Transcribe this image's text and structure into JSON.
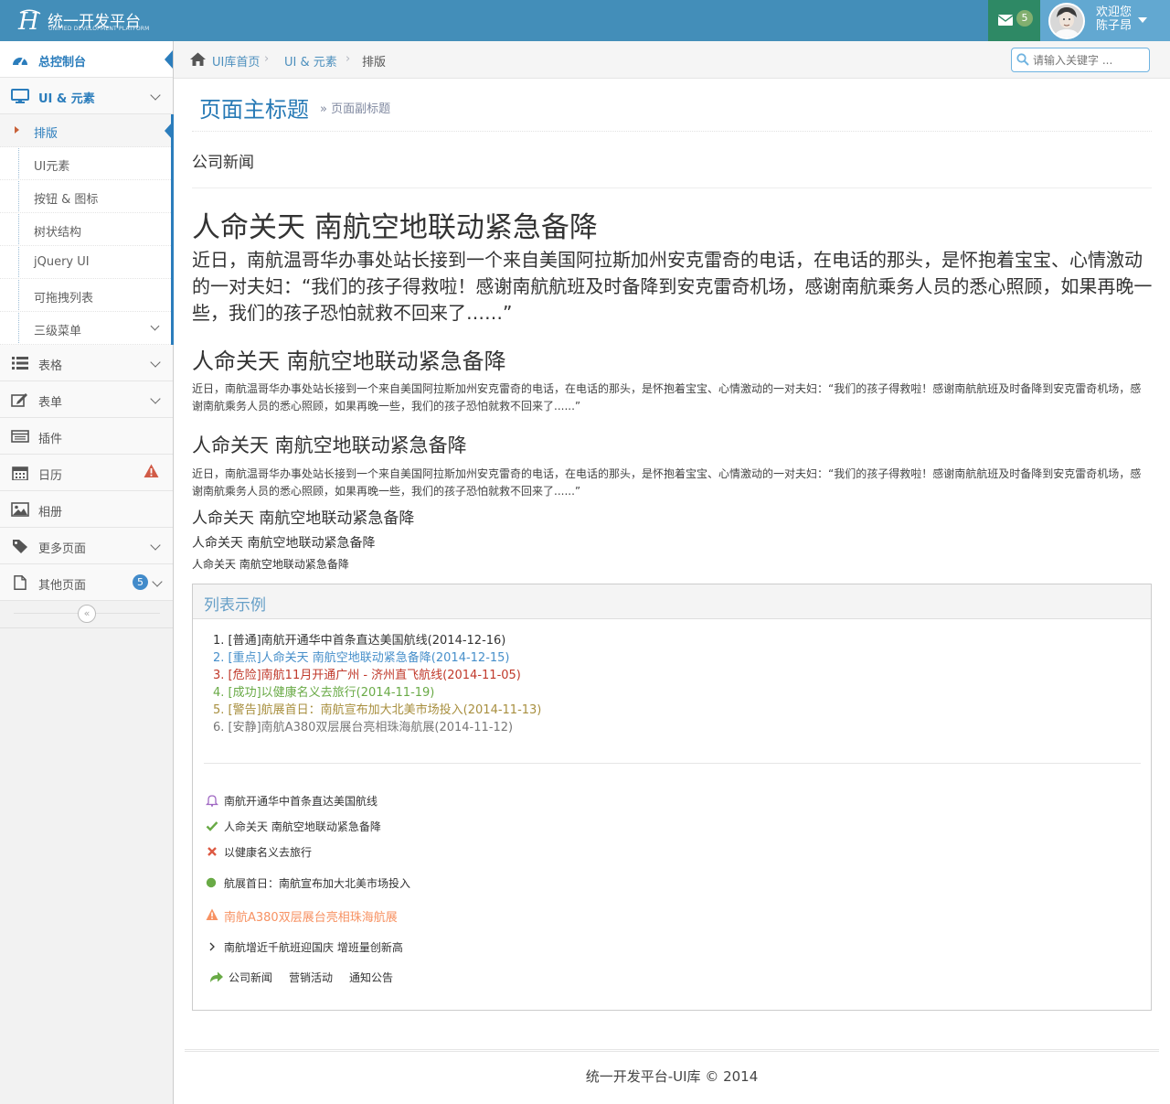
{
  "navbar": {
    "brand_title": "统一开发平台",
    "brand_subtitle": "UNIFIED DEVELOPMENT PLATFORM",
    "mail_count": "5",
    "welcome": "欢迎您",
    "username": "陈子昂",
    "colors": {
      "bar": "#438eb9",
      "mail_bg": "#2e8965",
      "user_bg": "#62a8d1"
    }
  },
  "sidebar": {
    "items": [
      {
        "label": "总控制台",
        "icon": "dashboard-icon"
      },
      {
        "label": "UI & 元素",
        "icon": "desktop-icon"
      },
      {
        "label": "表格",
        "icon": "list-icon"
      },
      {
        "label": "表单",
        "icon": "edit-icon"
      },
      {
        "label": "插件",
        "icon": "plugin-icon"
      },
      {
        "label": "日历",
        "icon": "calendar-icon"
      },
      {
        "label": "相册",
        "icon": "picture-icon"
      },
      {
        "label": "更多页面",
        "icon": "tag-icon"
      },
      {
        "label": "其他页面",
        "icon": "file-icon",
        "badge": "5"
      }
    ],
    "submenu": [
      "排版",
      "UI元素",
      "按钮 & 图标",
      "树状结构",
      "jQuery UI",
      "可拖拽列表",
      "三级菜单"
    ]
  },
  "breadcrumb": {
    "home": "UI库首页",
    "section": "UI & 元素",
    "current": "排版"
  },
  "search": {
    "placeholder": "请输入关键字 ..."
  },
  "page": {
    "title": "页面主标题",
    "subtitle": "» 页面副标题",
    "section_label": "公司新闻"
  },
  "article": {
    "heading": "人命关天 南航空地联动紧急备降",
    "body": "近日，南航温哥华办事处站长接到一个来自美国阿拉斯加州安克雷奇的电话，在电话的那头，是怀抱着宝宝、心情激动的一对夫妇：“我们的孩子得救啦！感谢南航航班及时备降到安克雷奇机场，感谢南航乘务人员的悉心照顾，如果再晚一些，我们的孩子恐怕就救不回来了……”",
    "body_small": "近日，南航温哥华办事处站长接到一个来自美国阿拉斯加州安克雷奇的电话，在电话的那头，是怀抱着宝宝、心情激动的一对夫妇：“我们的孩子得救啦！感谢南航航班及时备降到安克雷奇机场，感谢南航乘务人员的悉心照顾，如果再晚一些，我们的孩子恐怕就救不回来了......”"
  },
  "widget": {
    "title": "列表示例",
    "ordered": [
      {
        "text": "1. [普通]南航开通华中首条直达美国航线(2014-12-16)",
        "color": "#333333"
      },
      {
        "text": "2. [重点]人命关天 南航空地联动紧急备降(2014-12-15)",
        "color": "#478fca"
      },
      {
        "text": "3. [危险]南航11月开通广州 - 济州直飞航线(2014-11-05)",
        "color": "#c0392b"
      },
      {
        "text": "4. [成功]以健康名义去旅行(2014-11-19)",
        "color": "#69aa46"
      },
      {
        "text": "5. [警告]航展首日：南航宣布加大北美市场投入(2014-11-13)",
        "color": "#a88f3f"
      },
      {
        "text": "6. [安静]南航A380双层展台亮相珠海航展(2014-11-12)",
        "color": "#777777"
      }
    ],
    "icon_list": [
      {
        "text": "南航开通华中首条直达美国航线",
        "icon": "bell-icon",
        "color": "#a069c3"
      },
      {
        "text": "人命关天 南航空地联动紧急备降",
        "icon": "check-icon",
        "color": "#69aa46"
      },
      {
        "text": "以健康名义去旅行",
        "icon": "times-icon",
        "color": "#dd5a43"
      },
      {
        "text": "航展首日：南航宣布加大北美市场投入",
        "icon": "circle-icon",
        "color": "#69aa46"
      },
      {
        "text": "南航A380双层展台亮相珠海航展",
        "icon": "warning-icon",
        "color": "#f79263"
      },
      {
        "text": "南航增近千航班迎国庆 增班量创新高",
        "icon": "angle-right-icon",
        "color": "#333333"
      }
    ],
    "links": [
      "公司新闻",
      "营销活动",
      "通知公告"
    ]
  },
  "footer": {
    "text": "统一开发平台-UI库 © 2014"
  }
}
